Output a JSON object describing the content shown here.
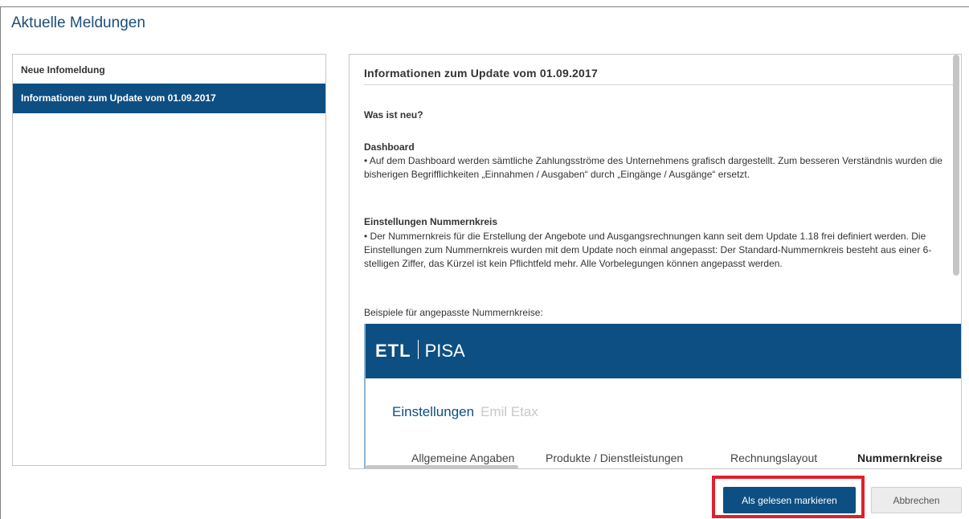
{
  "page": {
    "title": "Aktuelle Meldungen"
  },
  "list": {
    "items": [
      {
        "label": "Neue Infomeldung",
        "active": false
      },
      {
        "label": "Informationen zum Update vom 01.09.2017",
        "active": true
      }
    ]
  },
  "content": {
    "heading": "Informationen zum Update vom 01.09.2017",
    "subheading": "Was ist neu?",
    "sections": [
      {
        "title": "Dashboard",
        "text": "• Auf dem Dashboard werden sämtliche Zahlungsströme des Unternehmens grafisch dargestellt. Zum besseren Verständnis wurden die bisherigen Begrifflichkeiten „Einnahmen / Ausgaben“ durch „Eingänge / Ausgänge“ ersetzt."
      },
      {
        "title": "Einstellungen Nummernkreis",
        "text": "• Der Nummernkreis für die Erstellung der Angebote und Ausgangsrechnungen kann seit dem Update 1.18 frei definiert werden. Die Einstellungen zum Nummernkreis wurden mit dem Update noch einmal angepasst: Der Standard-Nummernkreis besteht aus einer 6-stelligen Ziffer, das Kürzel ist kein Pflichtfeld mehr. Alle Vorbelegungen können angepasst werden."
      }
    ],
    "examples_label": "Beispiele für angepasste Nummernkreise:",
    "embedded_screenshot": {
      "logo_etl": "ETL",
      "logo_pisa": "PISA",
      "settings_active": "Einstellungen",
      "settings_inactive": "Emil Etax",
      "tabs": [
        "Allgemeine Angaben",
        "Produkte / Dienstleistungen",
        "Rechnungslayout",
        "Nummernkreise"
      ]
    }
  },
  "buttons": {
    "mark_read": "Als gelesen markieren",
    "cancel": "Abbrechen"
  },
  "colors": {
    "primary": "#0d4f82",
    "title": "#1a4f7a",
    "highlight": "#e0202a"
  }
}
